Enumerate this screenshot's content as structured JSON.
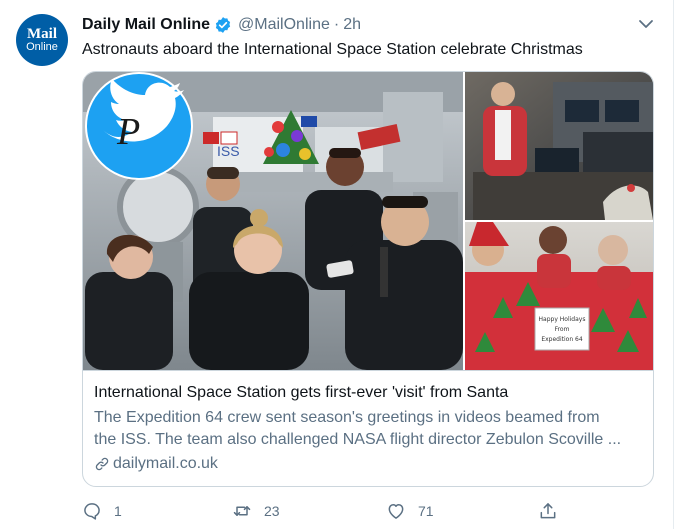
{
  "account": {
    "name": "Daily Mail Online",
    "handle": "@MailOnline",
    "separator": "·",
    "time": "2h",
    "avatar_line1": "Mail",
    "avatar_line2": "Online"
  },
  "tweet_text": "Astronauts aboard the International Space Station celebrate Christmas",
  "card": {
    "title": "International Space Station gets first-ever 'visit' from Santa",
    "description_line1": "The Expedition 64 crew sent season's greetings in videos beamed from",
    "description_line2": "the ISS. The team also challenged NASA flight director Zebulon Scoville ...",
    "domain": "dailymail.co.uk",
    "iss_sign": "ISS",
    "holiday_sign_line1": "Happy Holidays",
    "holiday_sign_line2": "From",
    "holiday_sign_line3": "Expedition 64"
  },
  "actions": {
    "reply_count": "1",
    "retweet_count": "23",
    "like_count": "71"
  },
  "icons": {
    "verified": "verified-badge-icon",
    "caret": "chevron-down-icon",
    "link": "link-icon",
    "reply": "reply-icon",
    "retweet": "retweet-icon",
    "like": "heart-icon",
    "share": "share-icon"
  },
  "colors": {
    "brand_blue": "#1da1f2",
    "avatar_blue": "#005ea6",
    "secondary_text": "#5b7083",
    "border": "#ccd6dd"
  }
}
